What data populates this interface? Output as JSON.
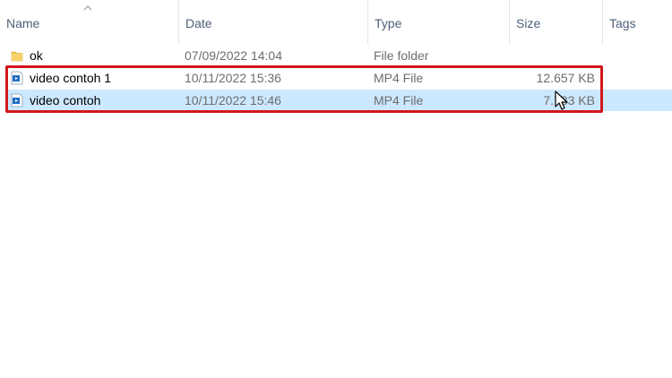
{
  "columns": {
    "name": "Name",
    "date": "Date",
    "type": "Type",
    "size": "Size",
    "tags": "Tags"
  },
  "icons": {
    "sort": "chevron-up-icon",
    "folder": "folder-icon",
    "video": "video-file-icon",
    "cursor": "mouse-pointer-icon"
  },
  "colors": {
    "selection": "#cce8ff",
    "highlight": "#d3161d",
    "folder": "#f3c34c",
    "file_icon": "#1f6fc2"
  },
  "files": [
    {
      "name": "ok",
      "date": "07/09/2022 14:04",
      "type": "File folder",
      "size": ""
    },
    {
      "name": "video contoh 1",
      "date": "10/11/2022 15:36",
      "type": "MP4 File",
      "size": "12.657 KB"
    },
    {
      "name": "video contoh",
      "date": "10/11/2022 15:46",
      "type": "MP4 File",
      "size": "7.733 KB",
      "size_visible": "7  33 KB"
    }
  ]
}
